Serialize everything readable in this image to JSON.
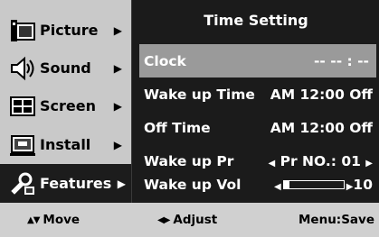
{
  "menu": {
    "items": [
      {
        "label": "Picture",
        "icon": "picture-icon",
        "arrow": "▶",
        "active": false
      },
      {
        "label": "Sound",
        "icon": "sound-icon",
        "arrow": "▶",
        "active": false
      },
      {
        "label": "Screen",
        "icon": "screen-icon",
        "arrow": "▶",
        "active": false
      },
      {
        "label": "Install",
        "icon": "install-icon",
        "arrow": "▶",
        "active": false
      },
      {
        "label": "Features",
        "icon": "features-icon",
        "arrow": "▶",
        "active": true
      }
    ]
  },
  "panel": {
    "title": "Time Setting",
    "rows": {
      "clock": {
        "name": "Clock",
        "value": "-- -- : --"
      },
      "wake_up_time": {
        "name": "Wake up Time",
        "value": "AM 12:00 Off"
      },
      "off_time": {
        "name": "Off Time",
        "value": "AM 12:00 Off"
      },
      "wake_up_pr": {
        "name": "Wake up Pr",
        "left_arrow": "◀",
        "value": "Pr NO.: 01",
        "right_arrow": "▶"
      },
      "wake_up_vol": {
        "name": "Wake up Vol",
        "left_arrow": "◀",
        "level": 10,
        "level_max": 100,
        "right_arrow": "▶",
        "value": "10"
      }
    }
  },
  "bottom_bar": {
    "move_glyph": "▲▼",
    "move_label": "Move",
    "adjust_glyph": "◀▶",
    "adjust_label": "Adjust",
    "save_label": "Menu:Save"
  },
  "colors": {
    "menu_bg": "#c9c9c9",
    "active_menu_bg": "#1c1c1c",
    "panel_bg": "#1b1b1b",
    "highlight_row": "#9a9a9a",
    "bottom_bar_bg": "#d0d0d0"
  }
}
